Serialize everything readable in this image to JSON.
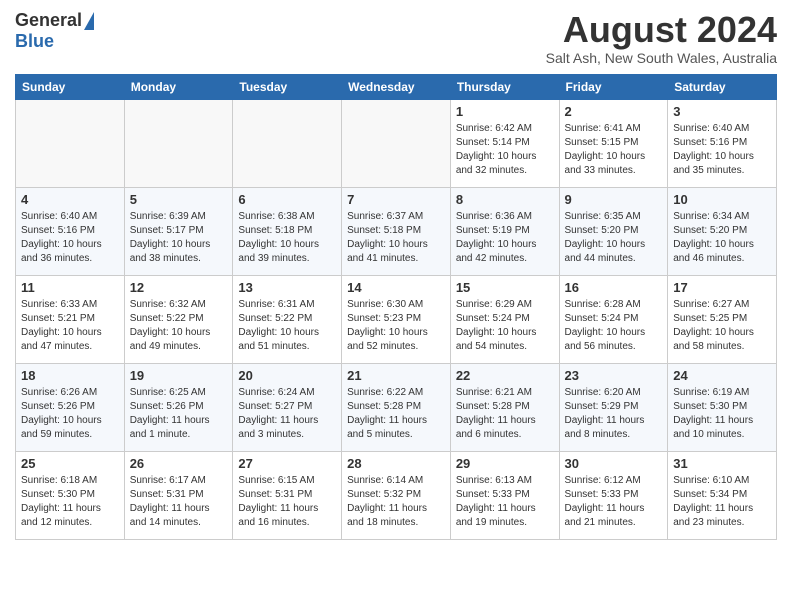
{
  "header": {
    "logo_general": "General",
    "logo_blue": "Blue",
    "month_title": "August 2024",
    "location": "Salt Ash, New South Wales, Australia"
  },
  "weekdays": [
    "Sunday",
    "Monday",
    "Tuesday",
    "Wednesday",
    "Thursday",
    "Friday",
    "Saturday"
  ],
  "weeks": [
    [
      {
        "day": "",
        "empty": true
      },
      {
        "day": "",
        "empty": true
      },
      {
        "day": "",
        "empty": true
      },
      {
        "day": "",
        "empty": true
      },
      {
        "day": "1",
        "sunrise": "6:42 AM",
        "sunset": "5:14 PM",
        "daylight": "10 hours and 32 minutes."
      },
      {
        "day": "2",
        "sunrise": "6:41 AM",
        "sunset": "5:15 PM",
        "daylight": "10 hours and 33 minutes."
      },
      {
        "day": "3",
        "sunrise": "6:40 AM",
        "sunset": "5:16 PM",
        "daylight": "10 hours and 35 minutes."
      }
    ],
    [
      {
        "day": "4",
        "sunrise": "6:40 AM",
        "sunset": "5:16 PM",
        "daylight": "10 hours and 36 minutes."
      },
      {
        "day": "5",
        "sunrise": "6:39 AM",
        "sunset": "5:17 PM",
        "daylight": "10 hours and 38 minutes."
      },
      {
        "day": "6",
        "sunrise": "6:38 AM",
        "sunset": "5:18 PM",
        "daylight": "10 hours and 39 minutes."
      },
      {
        "day": "7",
        "sunrise": "6:37 AM",
        "sunset": "5:18 PM",
        "daylight": "10 hours and 41 minutes."
      },
      {
        "day": "8",
        "sunrise": "6:36 AM",
        "sunset": "5:19 PM",
        "daylight": "10 hours and 42 minutes."
      },
      {
        "day": "9",
        "sunrise": "6:35 AM",
        "sunset": "5:20 PM",
        "daylight": "10 hours and 44 minutes."
      },
      {
        "day": "10",
        "sunrise": "6:34 AM",
        "sunset": "5:20 PM",
        "daylight": "10 hours and 46 minutes."
      }
    ],
    [
      {
        "day": "11",
        "sunrise": "6:33 AM",
        "sunset": "5:21 PM",
        "daylight": "10 hours and 47 minutes."
      },
      {
        "day": "12",
        "sunrise": "6:32 AM",
        "sunset": "5:22 PM",
        "daylight": "10 hours and 49 minutes."
      },
      {
        "day": "13",
        "sunrise": "6:31 AM",
        "sunset": "5:22 PM",
        "daylight": "10 hours and 51 minutes."
      },
      {
        "day": "14",
        "sunrise": "6:30 AM",
        "sunset": "5:23 PM",
        "daylight": "10 hours and 52 minutes."
      },
      {
        "day": "15",
        "sunrise": "6:29 AM",
        "sunset": "5:24 PM",
        "daylight": "10 hours and 54 minutes."
      },
      {
        "day": "16",
        "sunrise": "6:28 AM",
        "sunset": "5:24 PM",
        "daylight": "10 hours and 56 minutes."
      },
      {
        "day": "17",
        "sunrise": "6:27 AM",
        "sunset": "5:25 PM",
        "daylight": "10 hours and 58 minutes."
      }
    ],
    [
      {
        "day": "18",
        "sunrise": "6:26 AM",
        "sunset": "5:26 PM",
        "daylight": "10 hours and 59 minutes."
      },
      {
        "day": "19",
        "sunrise": "6:25 AM",
        "sunset": "5:26 PM",
        "daylight": "11 hours and 1 minute."
      },
      {
        "day": "20",
        "sunrise": "6:24 AM",
        "sunset": "5:27 PM",
        "daylight": "11 hours and 3 minutes."
      },
      {
        "day": "21",
        "sunrise": "6:22 AM",
        "sunset": "5:28 PM",
        "daylight": "11 hours and 5 minutes."
      },
      {
        "day": "22",
        "sunrise": "6:21 AM",
        "sunset": "5:28 PM",
        "daylight": "11 hours and 6 minutes."
      },
      {
        "day": "23",
        "sunrise": "6:20 AM",
        "sunset": "5:29 PM",
        "daylight": "11 hours and 8 minutes."
      },
      {
        "day": "24",
        "sunrise": "6:19 AM",
        "sunset": "5:30 PM",
        "daylight": "11 hours and 10 minutes."
      }
    ],
    [
      {
        "day": "25",
        "sunrise": "6:18 AM",
        "sunset": "5:30 PM",
        "daylight": "11 hours and 12 minutes."
      },
      {
        "day": "26",
        "sunrise": "6:17 AM",
        "sunset": "5:31 PM",
        "daylight": "11 hours and 14 minutes."
      },
      {
        "day": "27",
        "sunrise": "6:15 AM",
        "sunset": "5:31 PM",
        "daylight": "11 hours and 16 minutes."
      },
      {
        "day": "28",
        "sunrise": "6:14 AM",
        "sunset": "5:32 PM",
        "daylight": "11 hours and 18 minutes."
      },
      {
        "day": "29",
        "sunrise": "6:13 AM",
        "sunset": "5:33 PM",
        "daylight": "11 hours and 19 minutes."
      },
      {
        "day": "30",
        "sunrise": "6:12 AM",
        "sunset": "5:33 PM",
        "daylight": "11 hours and 21 minutes."
      },
      {
        "day": "31",
        "sunrise": "6:10 AM",
        "sunset": "5:34 PM",
        "daylight": "11 hours and 23 minutes."
      }
    ]
  ]
}
